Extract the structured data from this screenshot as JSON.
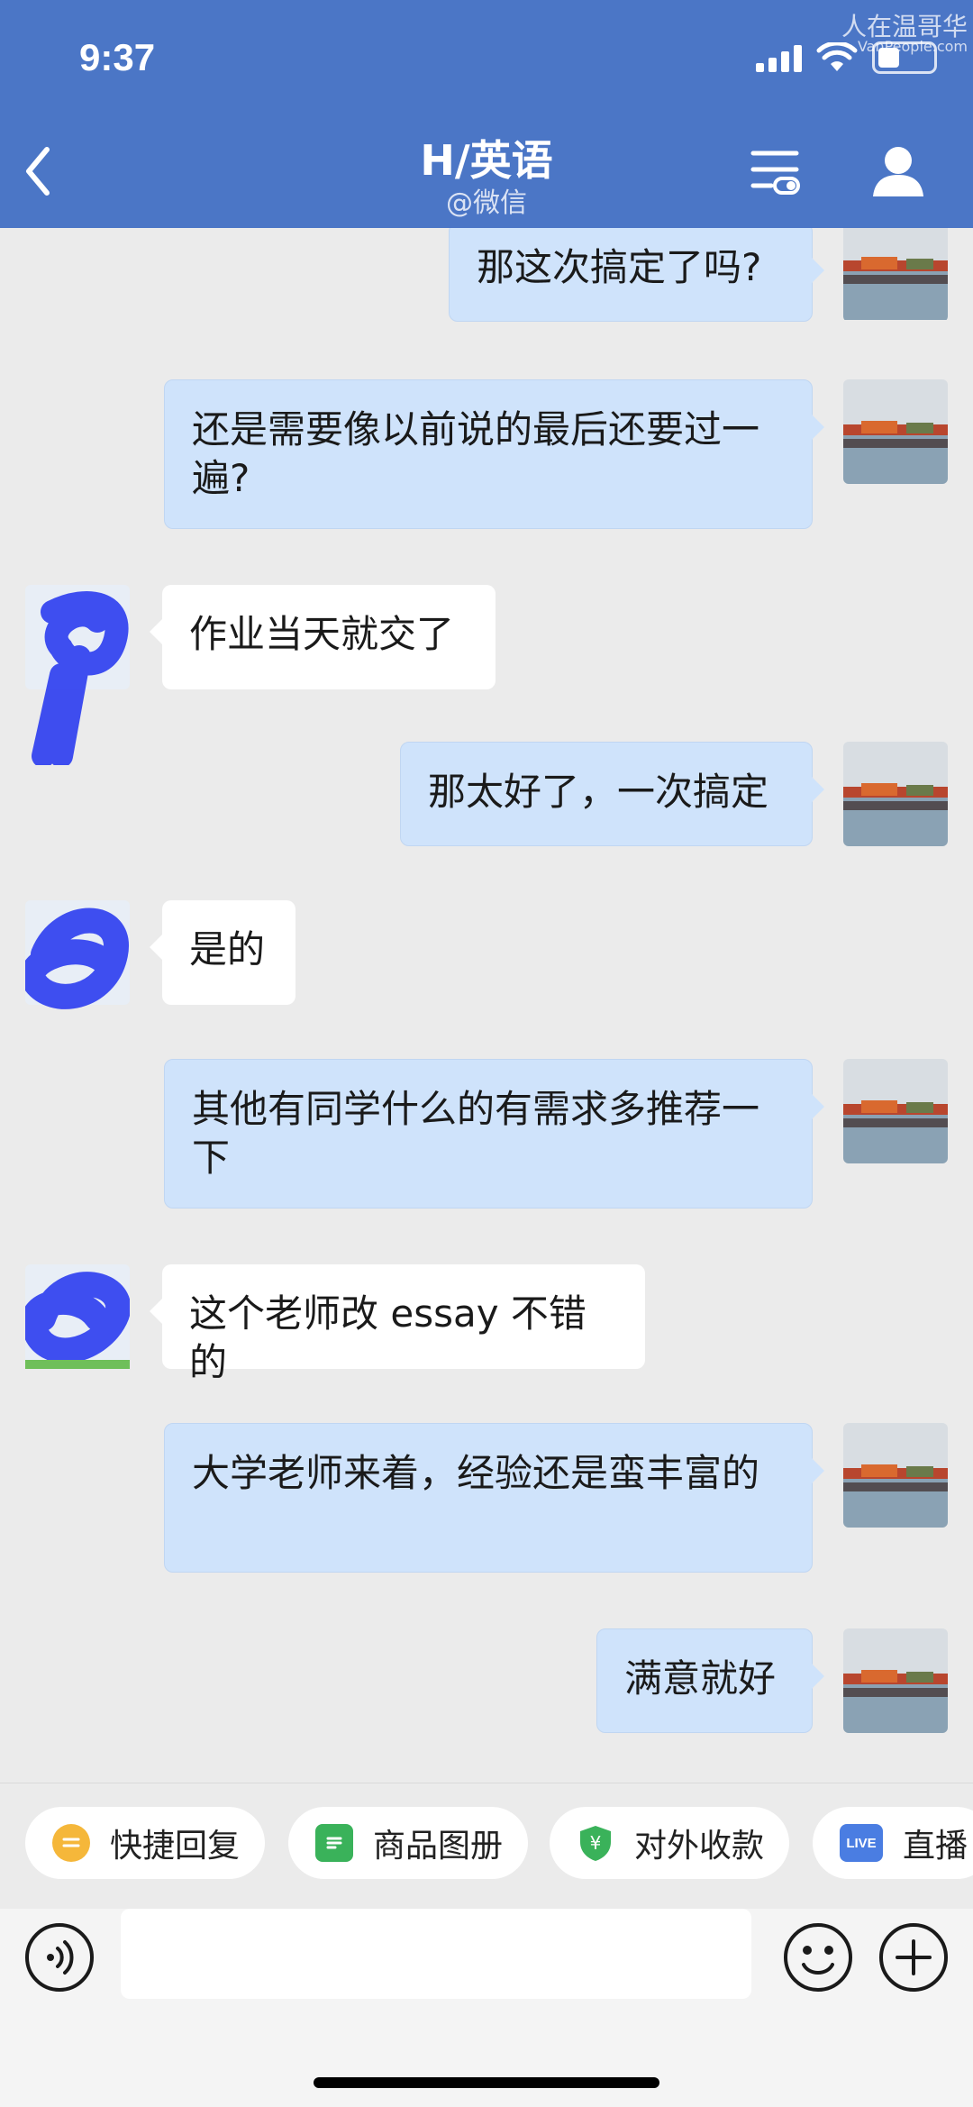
{
  "status_bar": {
    "time": "9:37",
    "watermark": "人在温哥华",
    "watermark_sub": "VanPeople.com"
  },
  "header": {
    "title": "H/英语",
    "subtitle": "@微信"
  },
  "colors": {
    "header_bg": "#4b76c6",
    "my_bubble": "#cfe3fb",
    "their_bubble": "#ffffff"
  },
  "messages": [
    {
      "from": "me",
      "text": "那这次搞定了吗?"
    },
    {
      "from": "me",
      "text": "还是需要像以前说的最后还要过一遍?"
    },
    {
      "from": "them",
      "text": "作业当天就交了"
    },
    {
      "from": "me",
      "text": "那太好了，一次搞定"
    },
    {
      "from": "them",
      "text": "是的"
    },
    {
      "from": "me",
      "text": "其他有同学什么的有需求多推荐一下"
    },
    {
      "from": "them",
      "text": "这个老师改 essay 不错的"
    },
    {
      "from": "me",
      "text": "大学老师来着，经验还是蛮丰富的"
    },
    {
      "from": "me",
      "text": "满意就好"
    }
  ],
  "quick_actions": [
    {
      "label": "快捷回复",
      "icon": "quick-reply-icon"
    },
    {
      "label": "商品图册",
      "icon": "catalog-icon"
    },
    {
      "label": "对外收款",
      "icon": "payment-icon"
    },
    {
      "label": "直播",
      "icon": "live-icon",
      "icon_text": "LIVE"
    }
  ],
  "input": {
    "placeholder": ""
  }
}
